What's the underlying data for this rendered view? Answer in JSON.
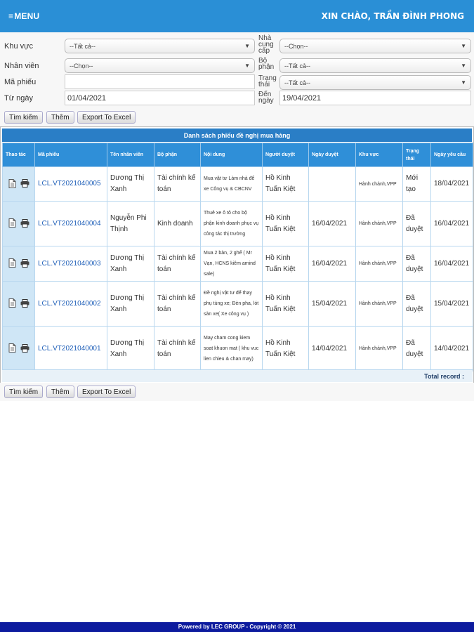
{
  "header": {
    "menu_label": "MENU",
    "menu_icon": "hamburger-icon",
    "greeting": "XIN CHÀO, TRẦN ĐÌNH PHONG",
    "background": "#2a8fd6"
  },
  "filters": {
    "khu_vuc": {
      "label": "Khu vực",
      "value": "--Tất cả--"
    },
    "nha_cung_cap": {
      "label_lines": [
        "Nhà",
        "cung",
        "cấp"
      ],
      "value": "--Chọn--"
    },
    "nhan_vien": {
      "label": "Nhân viên",
      "value": "--Chọn--"
    },
    "bo_phan": {
      "label_lines": [
        "Bộ",
        "phận"
      ],
      "value": "--Tất cả--"
    },
    "ma_phieu": {
      "label": "Mã phiếu",
      "value": ""
    },
    "trang_thai": {
      "label_lines": [
        "Trạng",
        "thái"
      ],
      "value": "--Tất cả--"
    },
    "tu_ngay": {
      "label": "Từ ngày",
      "value": "01/04/2021"
    },
    "den_ngay": {
      "label_lines": [
        "Đến",
        "ngày"
      ],
      "value": "19/04/2021"
    }
  },
  "buttons": {
    "search": "Tìm kiếm",
    "add": "Thêm",
    "export": "Export To Excel"
  },
  "grid": {
    "title": "Danh sách phiếu đề nghị mua hàng",
    "columns": [
      "Thao tác",
      "Mã phiếu",
      "Tên nhân viên",
      "Bộ phận",
      "Nội dung",
      "Người duyệt",
      "Ngày duyệt",
      "Khu vực",
      "Trạng thái",
      "Ngày yêu cầu"
    ],
    "rows": [
      {
        "code": "LCL.VT2021040005",
        "employee": "Dương Thị Xanh",
        "dept": "Tài chính kế toán",
        "content": "Mua vật tư Làm nhà để xe Công vụ & CBCNV",
        "approver": "Hồ Kinh Tuấn Kiệt",
        "approved_date": "",
        "area": "Hành chánh,VPP",
        "status": "Mới tạo",
        "request_date": "18/04/2021"
      },
      {
        "code": "LCL.VT2021040004",
        "employee": "Nguyễn Phi Thịnh",
        "dept": "Kinh doanh",
        "content": "Thuê xe ô tô cho bộ phận kinh doanh phục vụ công tác thị trường",
        "approver": "Hồ Kinh Tuấn Kiệt",
        "approved_date": "16/04/2021",
        "area": "Hành chánh,VPP",
        "status": "Đã duyệt",
        "request_date": "16/04/2021"
      },
      {
        "code": "LCL.VT2021040003",
        "employee": "Dương Thị Xanh",
        "dept": "Tài chính kế toán",
        "content": "Mua 2 bàn, 2 ghế ( Mr Vạn, HCNS kiêm amind sale)",
        "approver": "Hồ Kinh Tuấn Kiệt",
        "approved_date": "16/04/2021",
        "area": "Hành chánh,VPP",
        "status": "Đã duyệt",
        "request_date": "16/04/2021"
      },
      {
        "code": "LCL.VT2021040002",
        "employee": "Dương Thị Xanh",
        "dept": "Tài chính kế toán",
        "content": "Đề nghị vật tư để thay phụ tùng xe; Đèn pha, lót sàn xe( Xe công vụ )",
        "approver": "Hồ Kinh Tuấn Kiệt",
        "approved_date": "15/04/2021",
        "area": "Hành chánh,VPP",
        "status": "Đã duyệt",
        "request_date": "15/04/2021"
      },
      {
        "code": "LCL.VT2021040001",
        "employee": "Dương Thị Xanh",
        "dept": "Tài chính kế toán",
        "content": "May cham cong kiem soat khuon mat ( khu vuc lien chieu & chan may)",
        "approver": "Hồ Kinh Tuấn Kiệt",
        "approved_date": "14/04/2021",
        "area": "Hành chánh,VPP",
        "status": "Đã duyệt",
        "request_date": "14/04/2021"
      }
    ],
    "total_label": "Total record :"
  },
  "footer": {
    "text": "Powered by LEC GROUP - Copyright © 2021",
    "background": "#0d1b9e"
  }
}
